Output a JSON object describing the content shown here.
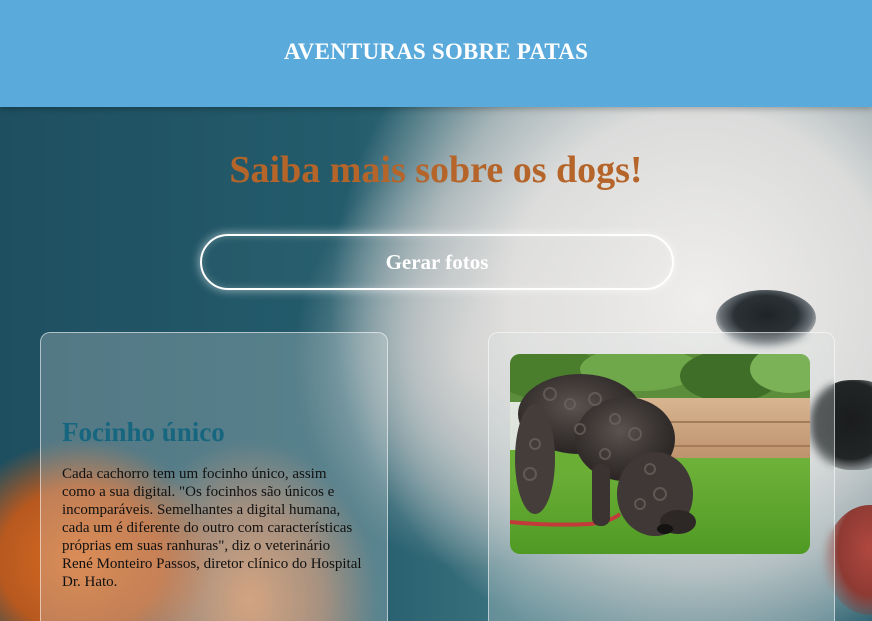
{
  "header": {
    "title": "AVENTURAS SOBRE PATAS"
  },
  "main": {
    "headline": "Saiba mais sobre os dogs!",
    "generate_button_label": "Gerar fotos"
  },
  "info_card": {
    "title": "Focinho único",
    "text": "Cada cachorro tem um focinho único, assim como a sua digital. \"Os focinhos são únicos e incomparáveis. Semelhantes a digital humana, cada um é diferente do outro com características próprias em suas ranhuras\", diz o veterinário René Monteiro Passos, diretor clínico do Hospital Dr. Hato."
  },
  "colors": {
    "header_bg": "#5aabdc",
    "headline": "#b5652a",
    "card_title": "#17667f"
  }
}
